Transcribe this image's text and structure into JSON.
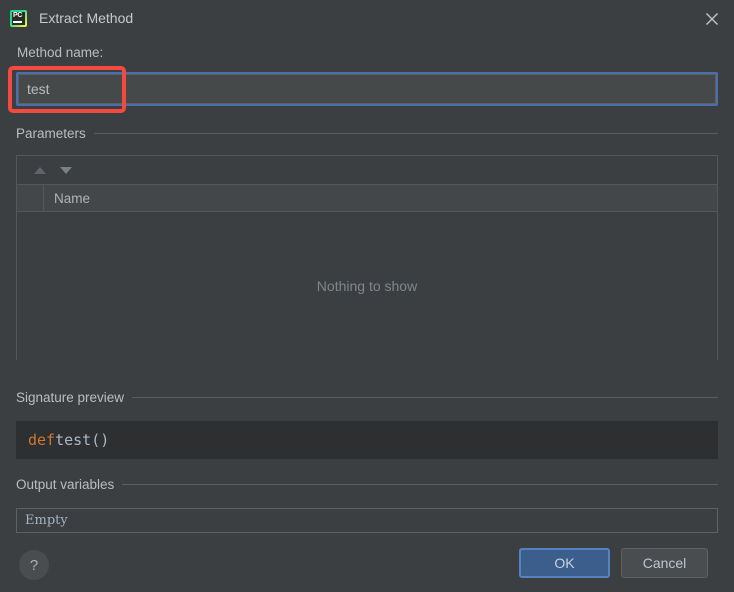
{
  "window": {
    "title": "Extract Method",
    "app_icon": "pycharm-icon",
    "close_icon": "close-icon"
  },
  "method_name": {
    "label": "Method name:",
    "value": "test",
    "placeholder": ""
  },
  "parameters": {
    "section_title": "Parameters",
    "toolbar": {
      "move_up_icon": "arrow-up-icon",
      "move_down_icon": "arrow-down-icon"
    },
    "columns": [
      "Name"
    ],
    "rows": [],
    "empty_message": "Nothing to show"
  },
  "signature_preview": {
    "section_title": "Signature preview",
    "keyword": "def",
    "rest": " test()"
  },
  "output_variables": {
    "section_title": "Output variables",
    "value": "Empty"
  },
  "footer": {
    "help_label": "?",
    "ok_label": "OK",
    "cancel_label": "Cancel"
  },
  "colors": {
    "background": "#3c3f41",
    "accent_blue": "#4b6eaf",
    "ok_button": "#3b5e8c",
    "annotation_red": "#f4493f",
    "keyword_orange": "#cc7832",
    "code_background": "#2d2f30"
  }
}
